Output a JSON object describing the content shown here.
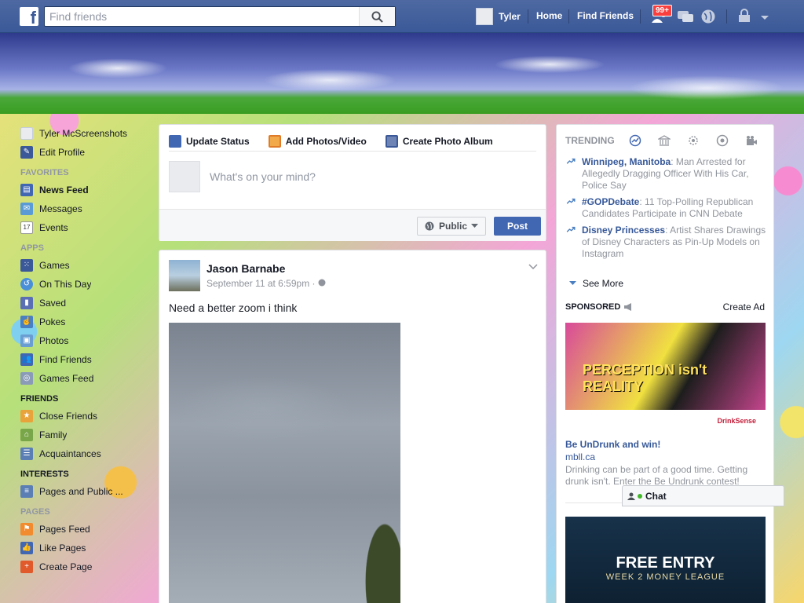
{
  "topbar": {
    "logo": "f",
    "search_placeholder": "Find friends",
    "user_name": "Tyler",
    "home_label": "Home",
    "find_friends_label": "Find Friends",
    "friend_requests_badge": "99+"
  },
  "leftnav": {
    "profile_name": "Tyler McScreenshots",
    "edit_profile": "Edit Profile",
    "favorites_heading": "FAVORITES",
    "favorites": [
      {
        "label": "News Feed",
        "icon": "news-feed-icon"
      },
      {
        "label": "Messages",
        "icon": "messages-icon"
      },
      {
        "label": "Events",
        "icon": "events-icon",
        "date": "17"
      }
    ],
    "apps_heading": "APPS",
    "apps": [
      {
        "label": "Games",
        "icon": "games-icon"
      },
      {
        "label": "On This Day",
        "icon": "on-this-day-icon"
      },
      {
        "label": "Saved",
        "icon": "saved-icon"
      },
      {
        "label": "Pokes",
        "icon": "pokes-icon"
      },
      {
        "label": "Photos",
        "icon": "photos-icon"
      },
      {
        "label": "Find Friends",
        "icon": "find-friends-icon"
      },
      {
        "label": "Games Feed",
        "icon": "games-feed-icon"
      }
    ],
    "friends_heading": "FRIENDS",
    "friends": [
      {
        "label": "Close Friends",
        "icon": "close-friends-icon"
      },
      {
        "label": "Family",
        "icon": "family-icon"
      },
      {
        "label": "Acquaintances",
        "icon": "acquaintances-icon"
      }
    ],
    "interests_heading": "INTERESTS",
    "interests": [
      {
        "label": "Pages and Public ...",
        "icon": "pages-public-icon"
      }
    ],
    "pages_heading": "PAGES",
    "pages": [
      {
        "label": "Pages Feed",
        "icon": "pages-feed-icon"
      },
      {
        "label": "Like Pages",
        "icon": "like-pages-icon"
      },
      {
        "label": "Create Page",
        "icon": "create-page-icon"
      }
    ]
  },
  "composer": {
    "tab_update_status": "Update Status",
    "tab_add_photos": "Add Photos/Video",
    "tab_create_album": "Create Photo Album",
    "placeholder": "What's on your mind?",
    "privacy_label": "Public",
    "post_label": "Post"
  },
  "post": {
    "author": "Jason Barnabe",
    "timestamp": "September 11 at 6:59pm",
    "meta_separator": "·",
    "text": "Need a better zoom i think"
  },
  "trending": {
    "title": "TRENDING",
    "items": [
      {
        "topic": "Winnipeg, Manitoba",
        "desc": "Man Arrested for Allegedly Dragging Officer With His Car, Police Say"
      },
      {
        "topic": "#GOPDebate",
        "desc": "11 Top-Polling Republican Candidates Participate in CNN Debate"
      },
      {
        "topic": "Disney Princesses",
        "desc": "Artist Shares Drawings of Disney Characters as Pin-Up Models on Instagram"
      }
    ],
    "see_more": "See More"
  },
  "sponsored": {
    "title": "SPONSORED",
    "create_ad": "Create Ad",
    "ad1": {
      "overlay": "PERCEPTION isn't REALITY",
      "brand": "DrinkSense",
      "title": "Be UnDrunk and win!",
      "url": "mbll.ca",
      "desc": "Drinking can be part of a good time. Getting drunk isn't. Enter the Be Undrunk contest!"
    },
    "ad2": {
      "title": "FREE ENTRY",
      "subtitle": "WEEK 2 MONEY LEAGUE"
    }
  },
  "chat": {
    "label": "Chat"
  }
}
